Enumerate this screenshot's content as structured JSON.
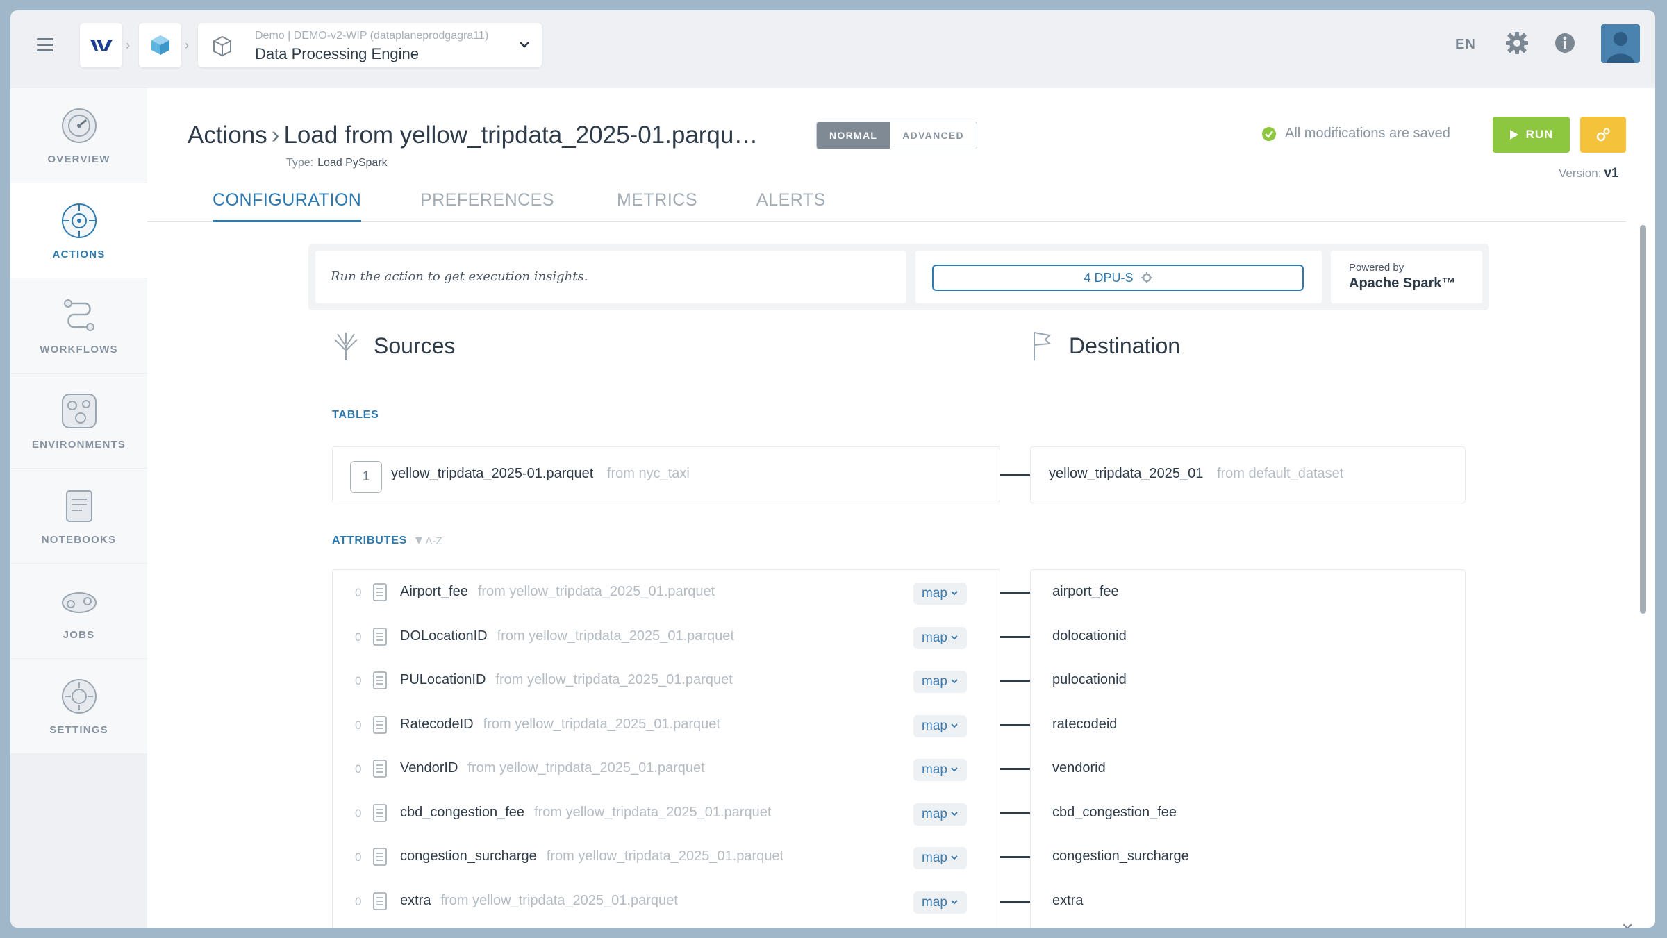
{
  "topbar": {
    "env_subtitle": "Demo | DEMO-v2-WIP (dataplaneprodgagra11)",
    "env_title": "Data Processing Engine",
    "language": "EN"
  },
  "sidenav": {
    "items": [
      {
        "label": "OVERVIEW",
        "icon": "overview-icon"
      },
      {
        "label": "ACTIONS",
        "icon": "actions-icon"
      },
      {
        "label": "WORKFLOWS",
        "icon": "workflows-icon"
      },
      {
        "label": "ENVIRONMENTS",
        "icon": "environments-icon"
      },
      {
        "label": "NOTEBOOKS",
        "icon": "notebooks-icon"
      },
      {
        "label": "JOBS",
        "icon": "jobs-icon"
      },
      {
        "label": "SETTINGS",
        "icon": "settings-icon"
      }
    ]
  },
  "header": {
    "breadcrumb_root": "Actions",
    "title": "Load from yellow_tripdata_2025-01.parqu…",
    "type_label": "Type:",
    "type_value": "Load PySpark",
    "mode_normal": "NORMAL",
    "mode_advanced": "ADVANCED",
    "saved_status": "All modifications are saved",
    "run_label": "RUN",
    "version_label": "Version:",
    "version_value": "v1"
  },
  "tabs": [
    "CONFIGURATION",
    "PREFERENCES",
    "METRICS",
    "ALERTS"
  ],
  "insights": {
    "message": "Run the action to get execution insights.",
    "dpu": "4 DPU-S",
    "powered_by": "Powered by",
    "engine": "Apache Spark™"
  },
  "sources": {
    "title": "Sources",
    "tables_label": "TABLES",
    "table": {
      "number": "1",
      "name": "yellow_tripdata_2025-01.parquet",
      "from": "from nyc_taxi"
    },
    "attributes_label": "ATTRIBUTES",
    "sort_label": "A-Z",
    "attributes": [
      {
        "index": "0",
        "name": "Airport_fee",
        "from": "from yellow_tripdata_2025_01.parquet",
        "map": "map"
      },
      {
        "index": "0",
        "name": "DOLocationID",
        "from": "from yellow_tripdata_2025_01.parquet",
        "map": "map"
      },
      {
        "index": "0",
        "name": "PULocationID",
        "from": "from yellow_tripdata_2025_01.parquet",
        "map": "map"
      },
      {
        "index": "0",
        "name": "RatecodeID",
        "from": "from yellow_tripdata_2025_01.parquet",
        "map": "map"
      },
      {
        "index": "0",
        "name": "VendorID",
        "from": "from yellow_tripdata_2025_01.parquet",
        "map": "map"
      },
      {
        "index": "0",
        "name": "cbd_congestion_fee",
        "from": "from yellow_tripdata_2025_01.parquet",
        "map": "map"
      },
      {
        "index": "0",
        "name": "congestion_surcharge",
        "from": "from yellow_tripdata_2025_01.parquet",
        "map": "map"
      },
      {
        "index": "0",
        "name": "extra",
        "from": "from yellow_tripdata_2025_01.parquet",
        "map": "map"
      }
    ]
  },
  "destination": {
    "title": "Destination",
    "table": {
      "name": "yellow_tripdata_2025_01",
      "from": "from default_dataset"
    },
    "attributes": [
      "airport_fee",
      "dolocationid",
      "pulocationid",
      "ratecodeid",
      "vendorid",
      "cbd_congestion_fee",
      "congestion_surcharge",
      "extra"
    ]
  },
  "colors": {
    "accent": "#2d7ab0",
    "run": "#8dc63f",
    "config_button": "#f4c33b",
    "saved_check": "#8dc63f"
  }
}
